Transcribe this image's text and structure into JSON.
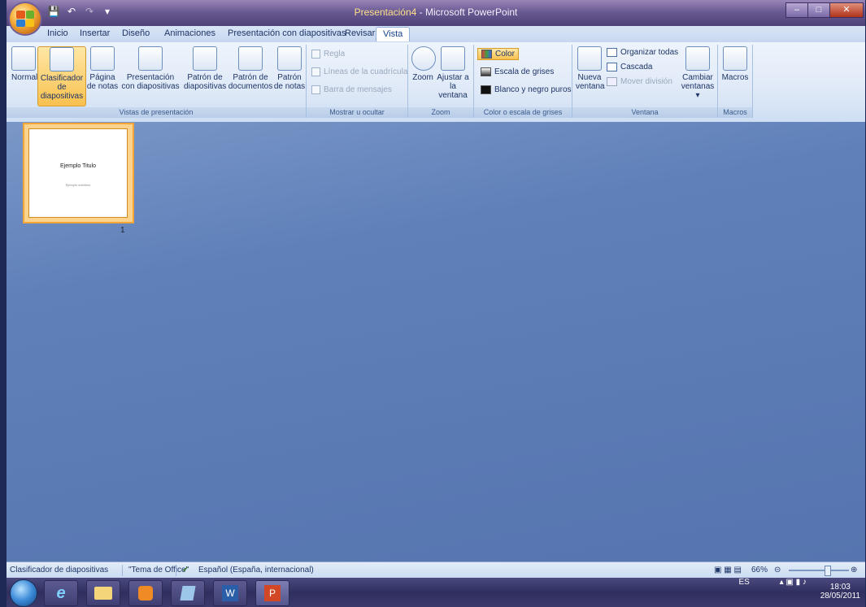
{
  "window": {
    "title_prefix": "Presentación4",
    "title_suffix": " - Microsoft PowerPoint"
  },
  "tabs": [
    "Inicio",
    "Insertar",
    "Diseño",
    "Animaciones",
    "Presentación con diapositivas",
    "Revisar",
    "Vista"
  ],
  "ribbon": {
    "vistas": {
      "label": "Vistas de presentación",
      "normal": "Normal",
      "clasificador_1": "Clasificador de",
      "clasificador_2": "diapositivas",
      "pagina_1": "Página",
      "pagina_2": "de notas",
      "presentacion_1": "Presentación",
      "presentacion_2": "con diapositivas",
      "patron_diap_1": "Patrón de",
      "patron_diap_2": "diapositivas",
      "patron_doc_1": "Patrón de",
      "patron_doc_2": "documentos",
      "patron_notas_1": "Patrón",
      "patron_notas_2": "de notas"
    },
    "mostrar": {
      "label": "Mostrar u ocultar",
      "regla": "Regla",
      "lineas": "Líneas de la cuadrícula",
      "barra": "Barra de mensajes"
    },
    "zoom": {
      "label": "Zoom",
      "zoom": "Zoom",
      "ajustar_1": "Ajustar a",
      "ajustar_2": "la ventana"
    },
    "color": {
      "label": "Color o escala de grises",
      "color": "Color",
      "grises": "Escala de grises",
      "blanco": "Blanco y negro puros"
    },
    "ventana": {
      "label": "Ventana",
      "nueva_1": "Nueva",
      "nueva_2": "ventana",
      "organizar": "Organizar todas",
      "cascada": "Cascada",
      "mover": "Mover división",
      "cambiar_1": "Cambiar",
      "cambiar_2": "ventanas"
    },
    "macros": {
      "label": "Macros",
      "macros": "Macros"
    }
  },
  "slides": [
    {
      "number": "1",
      "title": "Ejemplo Titulo",
      "subtitle": "Ejemplo subtítulo"
    }
  ],
  "status": {
    "view": "Clasificador de diapositivas",
    "theme": "\"Tema de Office\"",
    "language": "Español (España, internacional)",
    "zoom": "66%"
  },
  "taskbar": {
    "lang": "ES",
    "time": "18:03",
    "date": "28/05/2011"
  },
  "colors": {
    "accent": "#f3a537",
    "workspace": "#5f80b9"
  }
}
